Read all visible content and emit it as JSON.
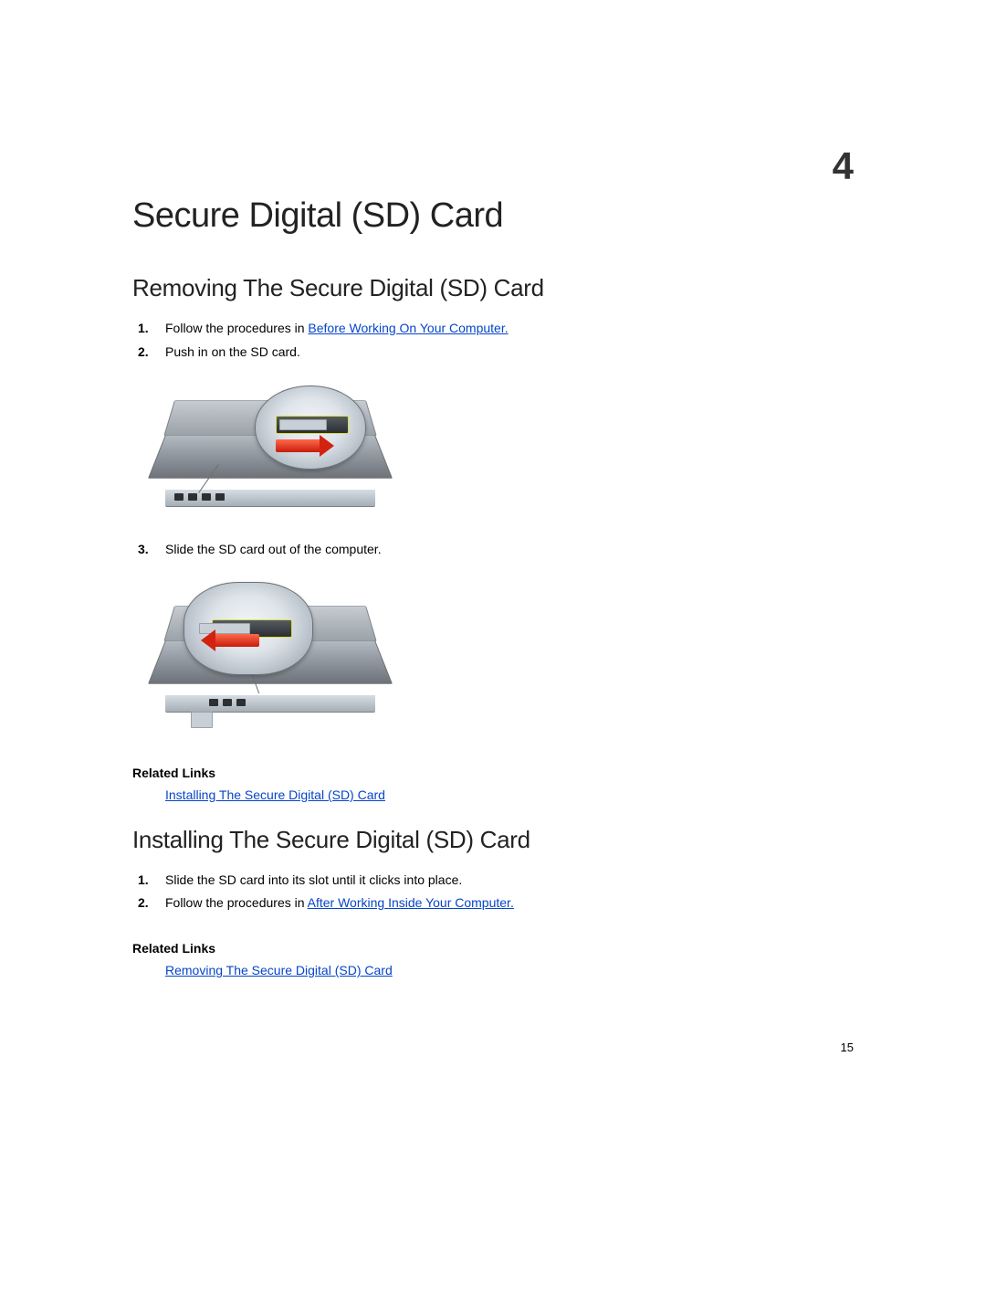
{
  "chapter": {
    "number": "4",
    "title": "Secure Digital (SD) Card"
  },
  "section_removing": {
    "title": "Removing The Secure Digital (SD) Card",
    "steps": {
      "s1_pre": "Follow the procedures in ",
      "s1_link": "Before Working On Your Computer.",
      "s2": "Push in on the SD card.",
      "s3": "Slide the SD card out of the computer."
    },
    "related": {
      "title": "Related Links",
      "link": "Installing The Secure Digital (SD) Card"
    }
  },
  "section_installing": {
    "title": "Installing The Secure Digital (SD) Card",
    "steps": {
      "s1": "Slide the SD card into its slot until it clicks into place.",
      "s2_pre": "Follow the procedures in ",
      "s2_link": "After Working Inside Your Computer."
    },
    "related": {
      "title": "Related Links",
      "link": "Removing The Secure Digital (SD) Card"
    }
  },
  "page_number": "15"
}
